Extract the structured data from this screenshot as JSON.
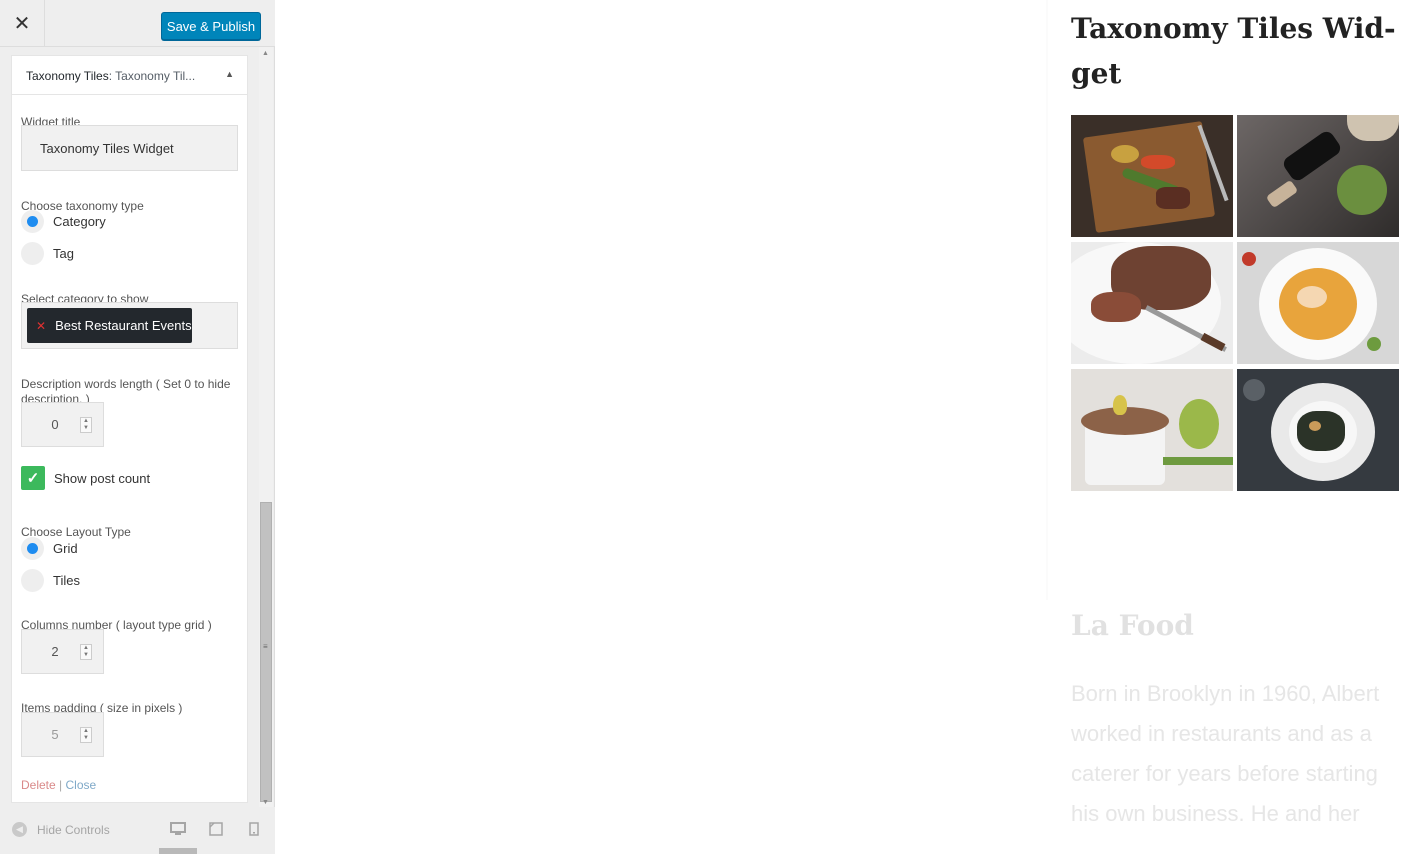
{
  "topbar": {
    "close_label": "✕",
    "publish_label": "Save & Publish"
  },
  "widget": {
    "header_title": "Taxonomy Tiles",
    "header_instance": "Taxonomy Til...",
    "title_label": "Widget title",
    "title_value": "Taxonomy Tiles Widget",
    "taxonomy_label": "Choose taxonomy type",
    "taxonomy_options": [
      {
        "label": "Category",
        "selected": true
      },
      {
        "label": "Tag",
        "selected": false
      }
    ],
    "category_label": "Select category to show",
    "category_selected": "Best Restaurant Events",
    "desc_label": "Description words length ( Set 0 to hide description. )",
    "desc_value": "0",
    "show_count_label": "Show post count",
    "show_count_checked": true,
    "layout_label": "Choose Layout Type",
    "layout_options": [
      {
        "label": "Grid",
        "selected": true
      },
      {
        "label": "Tiles",
        "selected": false
      }
    ],
    "columns_label": "Columns number ( layout type grid )",
    "columns_value": "2",
    "padding_label": "Items padding ( size in pixels )",
    "padding_value": "5",
    "delete_label": "Delete",
    "separator": "|",
    "close_label": "Close"
  },
  "footer": {
    "hide_controls_label": "Hide Controls",
    "devices": [
      "desktop-icon",
      "tablet-icon",
      "mobile-icon"
    ],
    "active_device": "desktop"
  },
  "preview": {
    "widget_title": "Taxonomy Tiles Wid-get",
    "tiles": [
      "grilled-vegetables-steak",
      "wine-bottle-salad",
      "sliced-steak-plate",
      "seafood-soup-bowl",
      "souffle-ramekin",
      "mussels-plate"
    ],
    "next_title": "La Food",
    "next_text": "Born in Brooklyn in 1960, Albert worked in restaurants and as a caterer for years before starting his own business. He and her"
  },
  "colors": {
    "publish": "#0085ba",
    "radio_selected": "#1e8cf0",
    "checkbox": "#3cb95c",
    "chip": "#23282d",
    "delete": "#d98989",
    "close": "#7fa9c8"
  }
}
